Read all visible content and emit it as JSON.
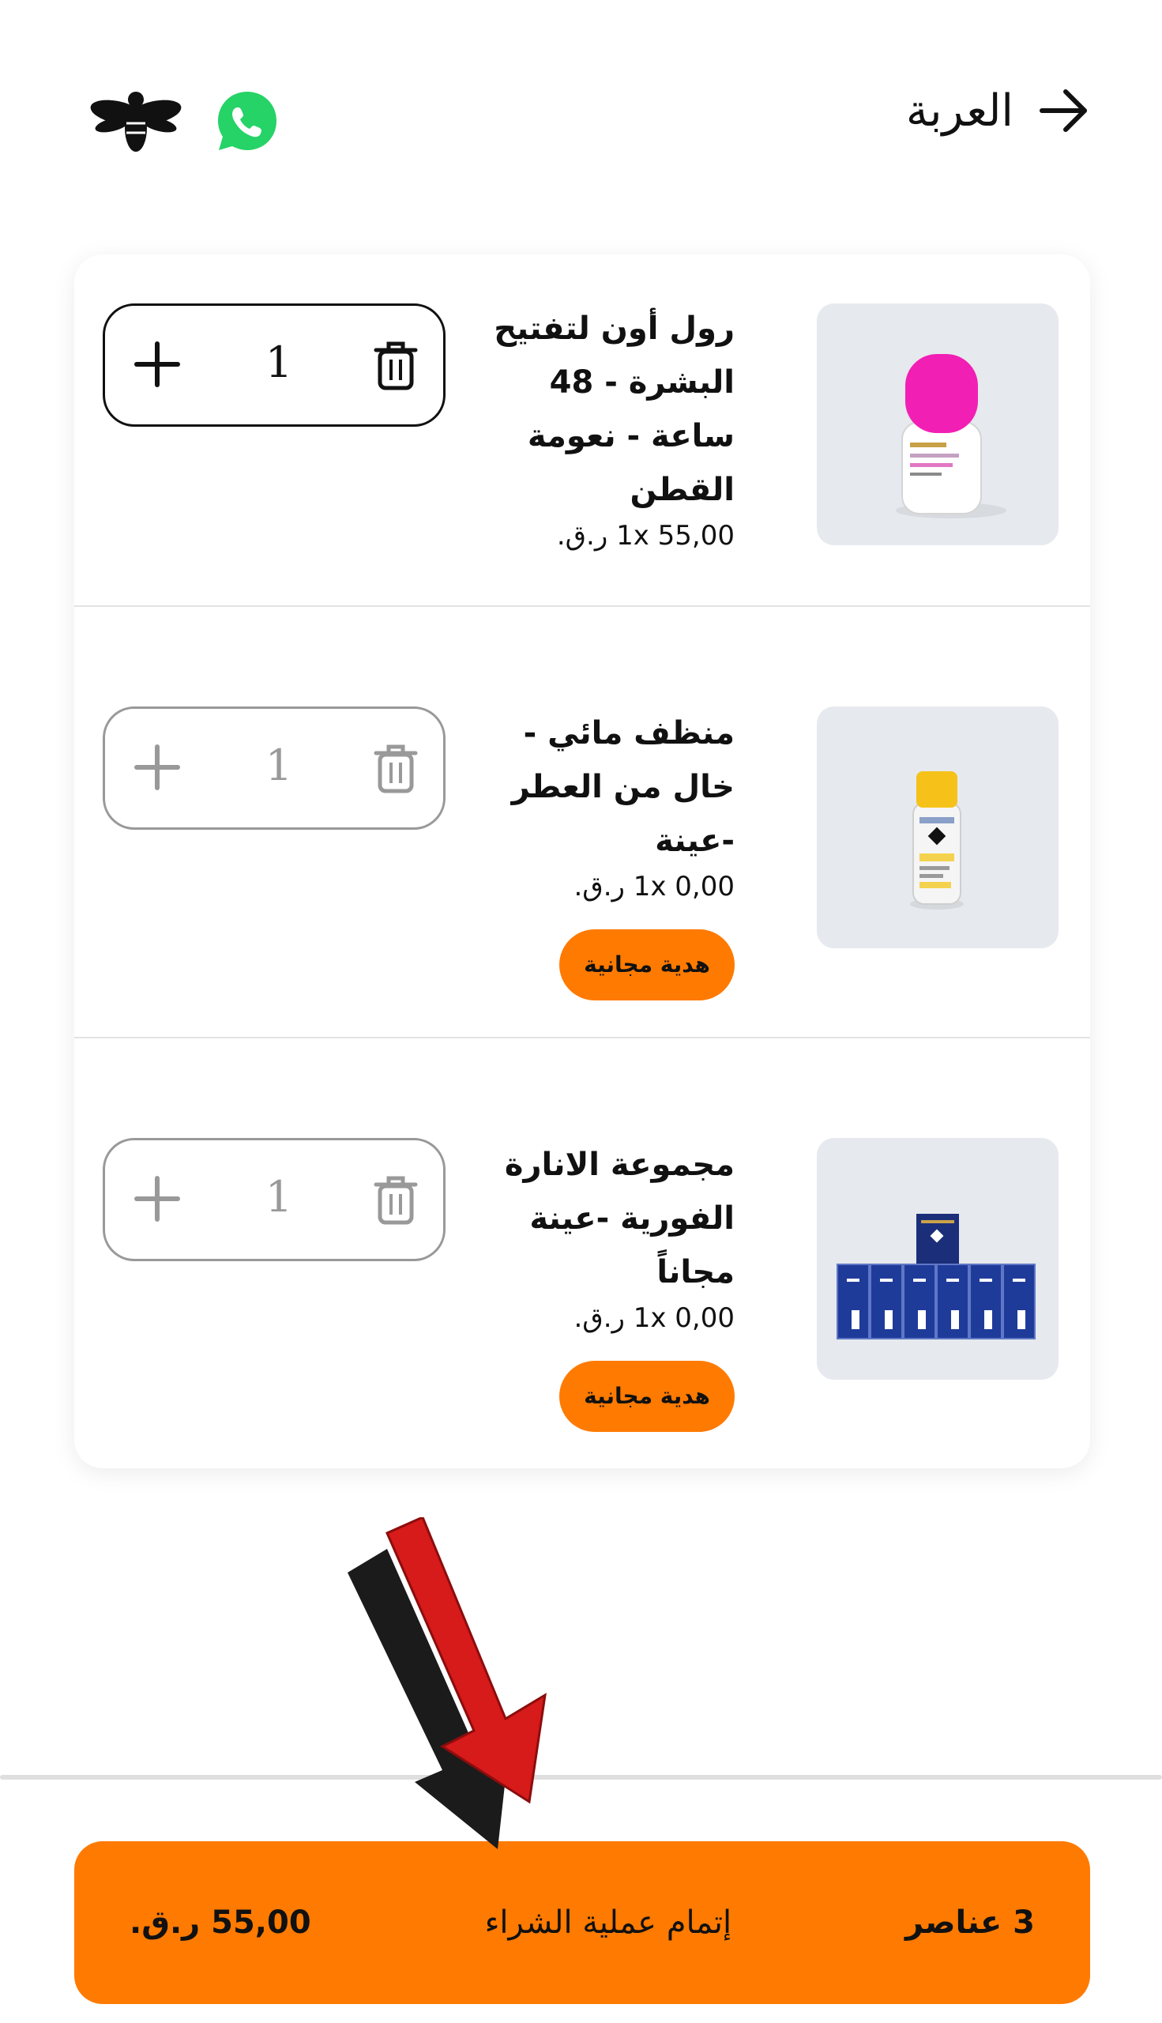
{
  "header": {
    "title": "العربة",
    "back_icon": "arrow-right-icon",
    "logo_icon": "bee-logo-icon",
    "chat_icon": "whatsapp-icon"
  },
  "cart": {
    "items": [
      {
        "name": "رول أون لتفتيح البشرة - 48 ساعة - نعومة القطن",
        "price": "1x 55,00 ر.ق.",
        "quantity": "1",
        "badge": ""
      },
      {
        "name": "منظف مائي - خال من العطر -عينة",
        "price": "1x 0,00 ر.ق.",
        "quantity": "1",
        "badge": "هدية مجانية"
      },
      {
        "name": "مجموعة الانارة الفورية -عينة مجاناً",
        "price": "1x 0,00 ر.ق.",
        "quantity": "1",
        "badge": "هدية مجانية"
      }
    ]
  },
  "checkout": {
    "count_label": "3 عناصر",
    "action_label": "إتمام عملية الشراء",
    "total": "55,00 ر.ق."
  },
  "colors": {
    "accent": "#ff7a00",
    "annotation_red": "#d71a1a",
    "whatsapp": "#25d366"
  }
}
